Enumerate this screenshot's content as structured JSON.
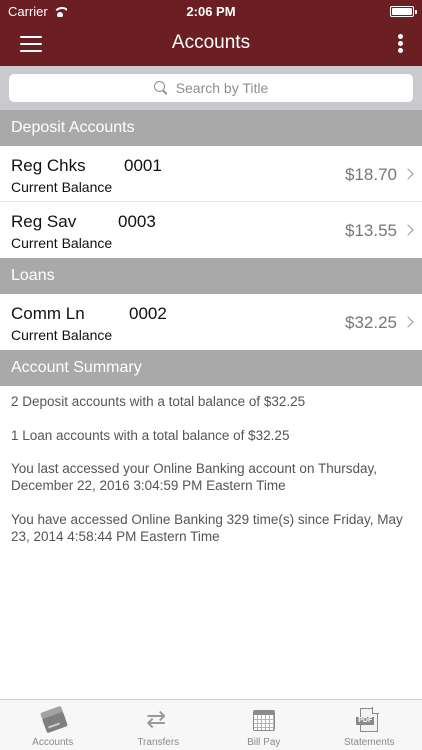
{
  "status_bar": {
    "carrier": "Carrier",
    "time": "2:06 PM"
  },
  "nav": {
    "title": "Accounts"
  },
  "search": {
    "placeholder": "Search by Title"
  },
  "sections": {
    "deposit": {
      "title": "Deposit Accounts",
      "accounts": [
        {
          "name": "Reg Chks",
          "number": "0001",
          "subtitle": "Current Balance",
          "balance": "$18.70"
        },
        {
          "name": "Reg Sav",
          "number": "0003",
          "subtitle": "Current Balance",
          "balance": "$13.55"
        }
      ]
    },
    "loans": {
      "title": "Loans",
      "accounts": [
        {
          "name": "Comm Ln",
          "number": "0002",
          "subtitle": "Current Balance",
          "balance": "$32.25"
        }
      ]
    },
    "summary": {
      "title": "Account Summary",
      "lines": [
        "2 Deposit accounts with a total balance of $32.25",
        "1 Loan accounts with a total balance of $32.25",
        "You last accessed your Online Banking account on Thursday, December 22, 2016 3:04:59 PM Eastern Time",
        "You have accessed Online Banking 329 time(s) since Friday, May 23, 2014 4:58:44 PM Eastern Time"
      ]
    }
  },
  "tabbar": {
    "tabs": [
      {
        "label": "Accounts",
        "icon": "cards-icon"
      },
      {
        "label": "Transfers",
        "icon": "transfer-icon"
      },
      {
        "label": "Bill Pay",
        "icon": "calendar-icon"
      },
      {
        "label": "Statements",
        "icon": "pdf-icon"
      }
    ]
  },
  "colors": {
    "header": "#6b1f23",
    "section_header": "#a9a9a9",
    "search_bg": "#c9c9ce"
  }
}
